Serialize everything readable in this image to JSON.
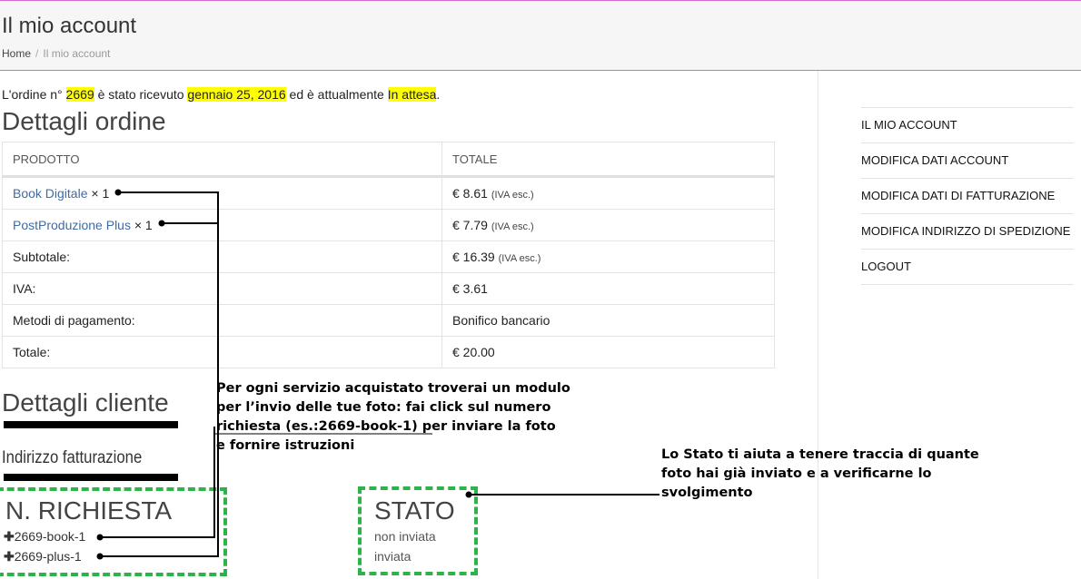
{
  "header": {
    "title": "Il mio account",
    "breadcrumb": {
      "home": "Home",
      "separator": "/",
      "current": "Il mio account"
    }
  },
  "order_notice": {
    "prefix": "L'ordine n° ",
    "order_number": "2669",
    "mid": " è stato ricevuto ",
    "date": "gennaio 25, 2016",
    "mid2": " ed è attualmente ",
    "status": "In attesa",
    "suffix": "."
  },
  "order_details": {
    "title": "Dettagli ordine",
    "columns": [
      "PRODOTTO",
      "TOTALE"
    ],
    "products": [
      {
        "name": "Book Digitale",
        "qty": "× 1",
        "total": "€ 8.61",
        "tax_note": "(IVA esc.)"
      },
      {
        "name": "PostProduzione Plus",
        "qty": "× 1",
        "total": "€ 7.79",
        "tax_note": "(IVA esc.)"
      }
    ],
    "subtotal": {
      "label": "Subtotale:",
      "value": "€ 16.39",
      "tax_note": "(IVA esc.)"
    },
    "iva": {
      "label": "IVA:",
      "value": "€ 3.61"
    },
    "payment": {
      "label": "Metodi di pagamento:",
      "value": "Bonifico bancario"
    },
    "total": {
      "label": "Totale:",
      "value": "€ 20.00"
    }
  },
  "customer": {
    "title": "Dettagli cliente",
    "billing_title": "Indirizzo fatturazione"
  },
  "requests": {
    "header": "N. RICHIESTA",
    "items": [
      {
        "icon": "plus-icon",
        "label": "2669-book-1"
      },
      {
        "icon": "plus-icon",
        "label": "2669-plus-1"
      }
    ]
  },
  "status_box": {
    "header": "STATO",
    "items": [
      "non inviata",
      "inviata"
    ]
  },
  "sidebar": {
    "items": [
      {
        "label": "IL MIO ACCOUNT"
      },
      {
        "label": "MODIFICA DATI ACCOUNT"
      },
      {
        "label": "MODIFICA DATI DI FATTURAZIONE"
      },
      {
        "label": "MODIFICA INDIRIZZO DI SPEDIZIONE"
      },
      {
        "label": "LOGOUT"
      }
    ]
  },
  "annotations": {
    "request_note": [
      "Per ogni servizio acquistato troverai un modulo",
      "per l’invio delle tue foto: fai click sul numero",
      "richiesta (es.:2669-book-1) per inviare la foto",
      "e fornire istruzioni"
    ],
    "status_note": [
      "Lo Stato ti aiuta a tenere traccia di quante",
      "foto hai già inviato e a verificarne lo",
      "svolgimento"
    ]
  },
  "colors": {
    "accent_line": "#d86bd0",
    "highlight": "#ffff00",
    "link": "#3f6ba3",
    "dashed_box": "#2db34a"
  }
}
